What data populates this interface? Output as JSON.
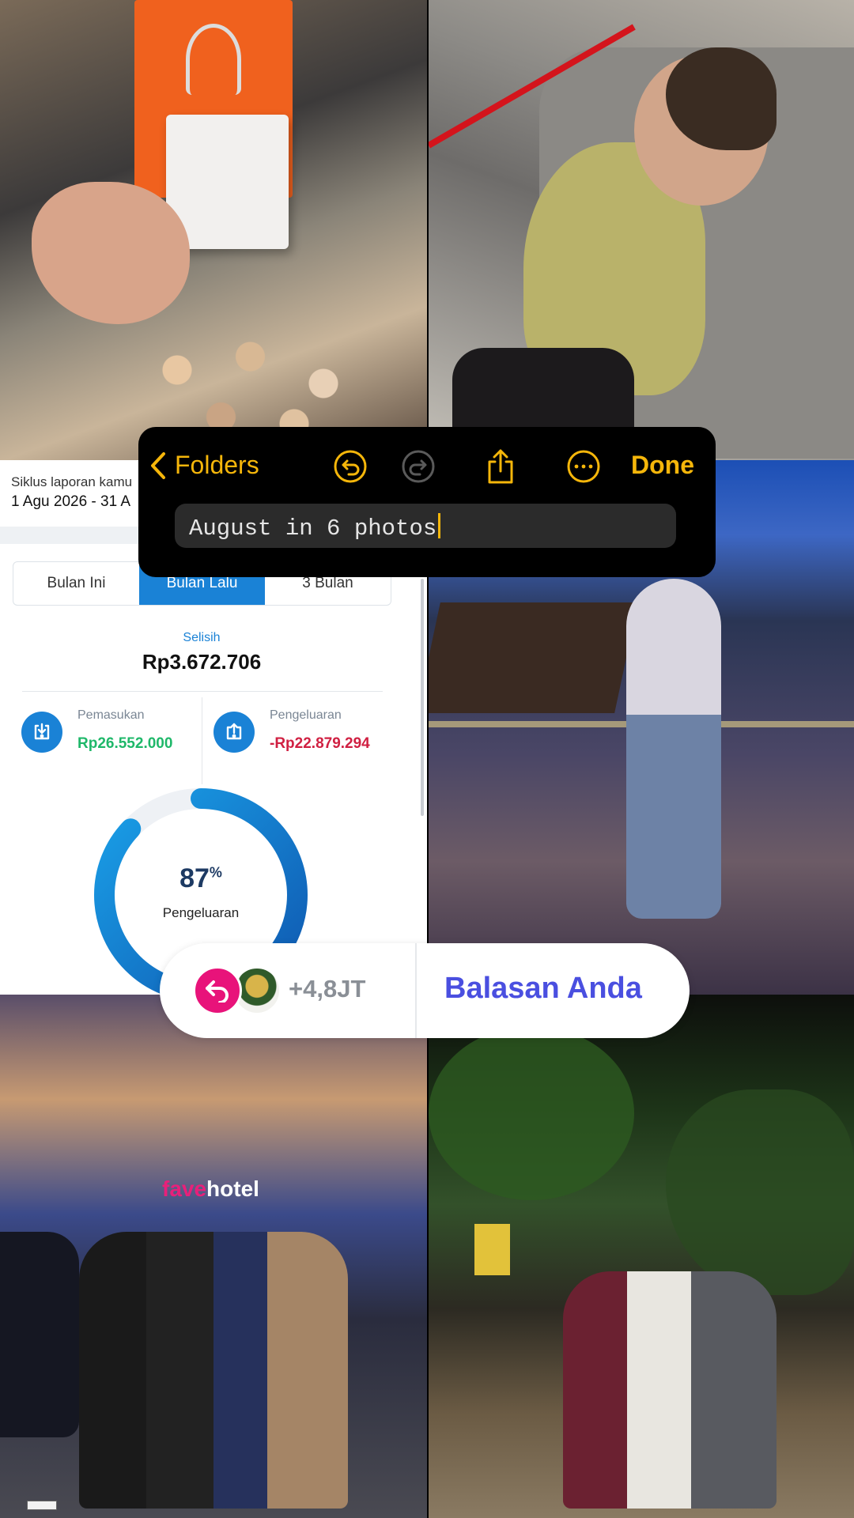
{
  "colors": {
    "notes_accent": "#f5b60a",
    "finance_blue": "#1a82d6",
    "income_green": "#1fb86a",
    "expense_red": "#d02042",
    "reply_pink": "#e8137a",
    "reply_text": "#4a4fe0"
  },
  "toolbar": {
    "back_label": "Folders",
    "done_label": "Done",
    "title_value": "August in 6 photos",
    "icons": [
      "chevron-left-icon",
      "undo-icon",
      "redo-icon",
      "share-icon",
      "more-icon"
    ]
  },
  "finance": {
    "cycle_label": "Siklus laporan kamu",
    "cycle_range": "1 Agu 2026 - 31 A",
    "tabs": [
      {
        "label": "Bulan Ini",
        "active": false
      },
      {
        "label": "Bulan Lalu",
        "active": true
      },
      {
        "label": "3 Bulan",
        "active": false
      }
    ],
    "selisih_label": "Selisih",
    "selisih_value": "Rp3.672.706",
    "income": {
      "label": "Pemasukan",
      "value": "Rp26.552.000",
      "icon": "download-box-icon"
    },
    "expense": {
      "label": "Pengeluaran",
      "value": "-Rp22.879.294",
      "icon": "upload-box-icon"
    },
    "gauge": {
      "percent": 87,
      "percent_unit": "%",
      "label": "Pengeluaran"
    }
  },
  "reply_pill": {
    "count": "+4,8JT",
    "reply_label": "Balasan Anda",
    "icon": "reply-arrow-icon"
  },
  "photos": {
    "hotel_sign": {
      "part1": "fave",
      "part2": "hotel"
    }
  }
}
